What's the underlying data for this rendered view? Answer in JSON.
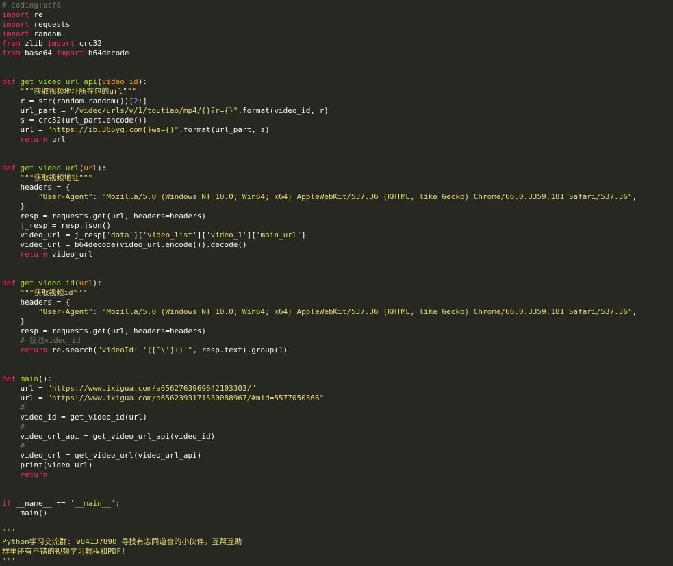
{
  "colors": {
    "background": "#272822",
    "text": "#f8f8f2",
    "keyword": "#f92672",
    "function": "#a6e22e",
    "string": "#e6db74",
    "comment": "#75715e",
    "number": "#ae81ff",
    "argument": "#fd971f"
  },
  "code": {
    "lines": [
      [
        [
          "cm",
          "# coding:utf8"
        ]
      ],
      [
        [
          "kw",
          "import"
        ],
        [
          "tx",
          " re"
        ]
      ],
      [
        [
          "kw",
          "import"
        ],
        [
          "tx",
          " requests"
        ]
      ],
      [
        [
          "kw",
          "import"
        ],
        [
          "tx",
          " random"
        ]
      ],
      [
        [
          "kw",
          "from"
        ],
        [
          "tx",
          " zlib "
        ],
        [
          "kw",
          "import"
        ],
        [
          "tx",
          " crc32"
        ]
      ],
      [
        [
          "kw",
          "from"
        ],
        [
          "tx",
          " base64 "
        ],
        [
          "kw",
          "import"
        ],
        [
          "tx",
          " b64decode"
        ]
      ],
      [],
      [],
      [
        [
          "kw",
          "def"
        ],
        [
          "tx",
          " "
        ],
        [
          "fn",
          "get_video_url_api"
        ],
        [
          "tx",
          "("
        ],
        [
          "arg",
          "video_id"
        ],
        [
          "tx",
          "):"
        ]
      ],
      [
        [
          "tx",
          "    "
        ],
        [
          "str",
          "\"\"\"获取视频地址所在包的url\"\"\""
        ]
      ],
      [
        [
          "tx",
          "    r = str(random.random())["
        ],
        [
          "num",
          "2"
        ],
        [
          "tx",
          ":]"
        ]
      ],
      [
        [
          "tx",
          "    url_part = "
        ],
        [
          "str",
          "\"/video/urls/v/1/toutiao/mp4/{}?r={}\""
        ],
        [
          "tx",
          ".format(video_id, r)"
        ]
      ],
      [
        [
          "tx",
          "    s = crc32(url_part.encode())"
        ]
      ],
      [
        [
          "tx",
          "    url = "
        ],
        [
          "str",
          "\"https://ib.365yg.com{}&s={}\""
        ],
        [
          "tx",
          ".format(url_part, s)"
        ]
      ],
      [
        [
          "tx",
          "    "
        ],
        [
          "kw",
          "return"
        ],
        [
          "tx",
          " url"
        ]
      ],
      [],
      [],
      [
        [
          "kw",
          "def"
        ],
        [
          "tx",
          " "
        ],
        [
          "fn",
          "get_video_url"
        ],
        [
          "tx",
          "("
        ],
        [
          "arg",
          "url"
        ],
        [
          "tx",
          "):"
        ]
      ],
      [
        [
          "tx",
          "    "
        ],
        [
          "str",
          "\"\"\"获取视频地址\"\"\""
        ]
      ],
      [
        [
          "tx",
          "    headers = {"
        ]
      ],
      [
        [
          "tx",
          "        "
        ],
        [
          "str",
          "\"User-Agent\""
        ],
        [
          "tx",
          ": "
        ],
        [
          "str",
          "\"Mozilla/5.0 (Windows NT 10.0; Win64; x64) AppleWebKit/537.36 (KHTML, like Gecko) Chrome/66.0.3359.181 Safari/537.36\""
        ],
        [
          "tx",
          ","
        ]
      ],
      [
        [
          "tx",
          "    }"
        ]
      ],
      [
        [
          "tx",
          "    resp = requests.get(url, headers=headers)"
        ]
      ],
      [
        [
          "tx",
          "    j_resp = resp.json()"
        ]
      ],
      [
        [
          "tx",
          "    video_url = j_resp["
        ],
        [
          "str",
          "'data'"
        ],
        [
          "tx",
          "]["
        ],
        [
          "str",
          "'video_list'"
        ],
        [
          "tx",
          "]["
        ],
        [
          "str",
          "'video_1'"
        ],
        [
          "tx",
          "]["
        ],
        [
          "str",
          "'main_url'"
        ],
        [
          "tx",
          "]"
        ]
      ],
      [
        [
          "tx",
          "    video_url = b64decode(video_url.encode()).decode()"
        ]
      ],
      [
        [
          "tx",
          "    "
        ],
        [
          "kw",
          "return"
        ],
        [
          "tx",
          " video_url"
        ]
      ],
      [],
      [],
      [
        [
          "kw",
          "def"
        ],
        [
          "tx",
          " "
        ],
        [
          "fn",
          "get_video_id"
        ],
        [
          "tx",
          "("
        ],
        [
          "arg",
          "url"
        ],
        [
          "tx",
          "):"
        ]
      ],
      [
        [
          "tx",
          "    "
        ],
        [
          "str",
          "\"\"\"获取视频id\"\"\""
        ]
      ],
      [
        [
          "tx",
          "    headers = {"
        ]
      ],
      [
        [
          "tx",
          "        "
        ],
        [
          "str",
          "\"User-Agent\""
        ],
        [
          "tx",
          ": "
        ],
        [
          "str",
          "\"Mozilla/5.0 (Windows NT 10.0; Win64; x64) AppleWebKit/537.36 (KHTML, like Gecko) Chrome/66.0.3359.181 Safari/537.36\""
        ],
        [
          "tx",
          ","
        ]
      ],
      [
        [
          "tx",
          "    }"
        ]
      ],
      [
        [
          "tx",
          "    resp = requests.get(url, headers=headers)"
        ]
      ],
      [
        [
          "tx",
          "    "
        ],
        [
          "cm",
          "# 获取video_id"
        ]
      ],
      [
        [
          "tx",
          "    "
        ],
        [
          "kw",
          "return"
        ],
        [
          "tx",
          " re.search("
        ],
        [
          "str",
          "\"videoId: '([^\\']+)'\""
        ],
        [
          "tx",
          ", resp.text).group("
        ],
        [
          "num",
          "1"
        ],
        [
          "tx",
          ")"
        ]
      ],
      [],
      [],
      [
        [
          "kw",
          "def"
        ],
        [
          "tx",
          " "
        ],
        [
          "fn",
          "main"
        ],
        [
          "tx",
          "():"
        ]
      ],
      [
        [
          "tx",
          "    url = "
        ],
        [
          "str",
          "\"https://www.ixigua.com/a6562763969642103303/\""
        ]
      ],
      [
        [
          "tx",
          "    url = "
        ],
        [
          "str",
          "\"https://www.ixigua.com/a6562393171530088967/#mid=5577050366\""
        ]
      ],
      [
        [
          "tx",
          "    "
        ],
        [
          "cm",
          "#"
        ]
      ],
      [
        [
          "tx",
          "    video_id = get_video_id(url)"
        ]
      ],
      [
        [
          "tx",
          "    "
        ],
        [
          "cm",
          "#"
        ]
      ],
      [
        [
          "tx",
          "    video_url_api = get_video_url_api(video_id)"
        ]
      ],
      [
        [
          "tx",
          "    "
        ],
        [
          "cm",
          "#"
        ]
      ],
      [
        [
          "tx",
          "    video_url = get_video_url(video_url_api)"
        ]
      ],
      [
        [
          "tx",
          "    print(video_url)"
        ]
      ],
      [
        [
          "tx",
          "    "
        ],
        [
          "kw",
          "return"
        ]
      ],
      [],
      [],
      [
        [
          "kw",
          "if"
        ],
        [
          "tx",
          " __name__ == "
        ],
        [
          "str",
          "'__main__'"
        ],
        [
          "tx",
          ":"
        ]
      ],
      [
        [
          "tx",
          "    main()"
        ]
      ],
      [],
      [
        [
          "str",
          "'''"
        ]
      ],
      [
        [
          "str",
          "Python学习交流群: 984137898 寻找有志同道合的小伙伴，互帮互助"
        ]
      ],
      [
        [
          "str",
          "群里还有不错的视频学习教程和PDF!"
        ]
      ],
      [
        [
          "str",
          "'''"
        ]
      ]
    ]
  }
}
